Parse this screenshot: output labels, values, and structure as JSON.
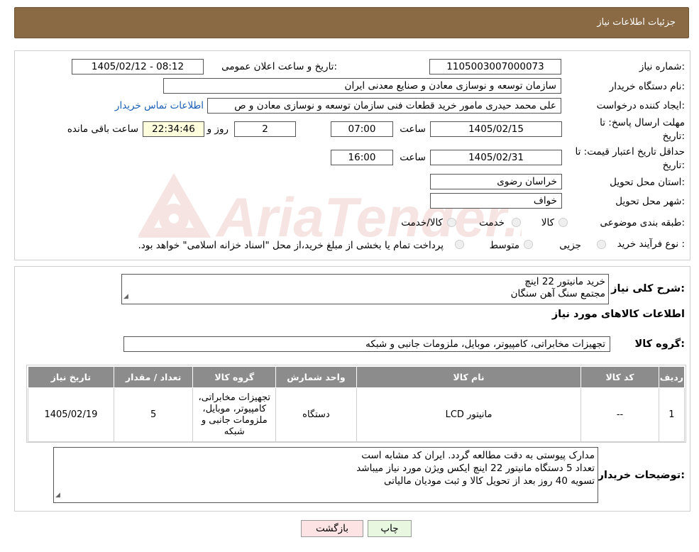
{
  "header": {
    "title": "جزئیات اطلاعات نیاز"
  },
  "watermark": {
    "text": "AriaTender.neT",
    "color": "#c0392b"
  },
  "form": {
    "need_number_label": "شماره نیاز:",
    "need_number": "1105003007000073",
    "announce_label": "تاریخ و ساعت اعلان عمومی:",
    "announce_value": "1405/02/12 - 08:12",
    "buyer_label": "نام دستگاه خریدار:",
    "buyer_value": "سازمان توسعه و نوسازی معادن و صنایع معدنی ایران",
    "creator_label": "ایجاد کننده درخواست:",
    "creator_value": "علی محمد حیدری مامور خرید قطعات فنی سازمان توسعه و نوسازی معادن و ص",
    "contact_link": "اطلاعات تماس خریدار",
    "deadline_label_1": "مهلت ارسال پاسخ: تا",
    "deadline_label_2": "تاریخ:",
    "deadline_date": "1405/02/15",
    "time_label": "ساعت",
    "deadline_time": "07:00",
    "days_value": "2",
    "days_label": "روز و",
    "remaining_time": "22:34:46",
    "remaining_label": "ساعت باقی مانده",
    "validity_label_1": "حداقل تاریخ اعتبار قیمت: تا",
    "validity_label_2": "تاریخ:",
    "validity_date": "1405/02/31",
    "validity_time": "16:00",
    "province_label": "استان محل تحویل:",
    "province_value": "خراسان رضوی",
    "city_label": "شهر محل تحویل:",
    "city_value": "خواف",
    "category_label": "طبقه بندی موضوعی:",
    "category_options": [
      "کالا",
      "خدمت",
      "کالا/خدمت"
    ],
    "process_label": "نوع فرآیند خرید :",
    "process_options": [
      "جزیی",
      "متوسط"
    ],
    "process_note": "پرداخت تمام یا بخشی از مبلغ خرید،از محل \"اسناد خزانه اسلامی\" خواهد بود."
  },
  "description": {
    "label": "شرح کلی نیاز:",
    "line1": "خرید مانیتور 22 اینچ",
    "line2": "مجتمع سنگ آهن سنگان"
  },
  "goods_info_title": "اطلاعات کالاهای مورد نیاز",
  "goods_group": {
    "label": "گروه کالا:",
    "value": "تجهیزات مخابراتی، کامپیوتر، موبایل، ملزومات جانبی و شبکه"
  },
  "table": {
    "headers": [
      "ردیف",
      "کد کالا",
      "نام کالا",
      "واحد شمارش",
      "گروه کالا",
      "تعداد / مقدار",
      "تاریخ نیاز"
    ],
    "rows": [
      [
        "1",
        "--",
        "مانیتور LCD",
        "دستگاه",
        "تجهیزات مخابراتی، کامپیوتر، موبایل، ملزومات جانبی و شبکه",
        "5",
        "1405/02/19"
      ]
    ]
  },
  "buyer_notes": {
    "label": "توضیحات خریدار:",
    "line1": "مدارک پیوستی به دقت مطالعه گردد. ایران کد مشابه است",
    "line2": "تعداد 5 دستگاه مانیتور 22 اینچ ایکس ویژن مورد نیاز میباشد",
    "line3": "تسویه 40 روز بعد از تحویل کالا و ثبت مودیان مالیاتی"
  },
  "buttons": {
    "print": "چاپ",
    "back": "بازگشت"
  }
}
